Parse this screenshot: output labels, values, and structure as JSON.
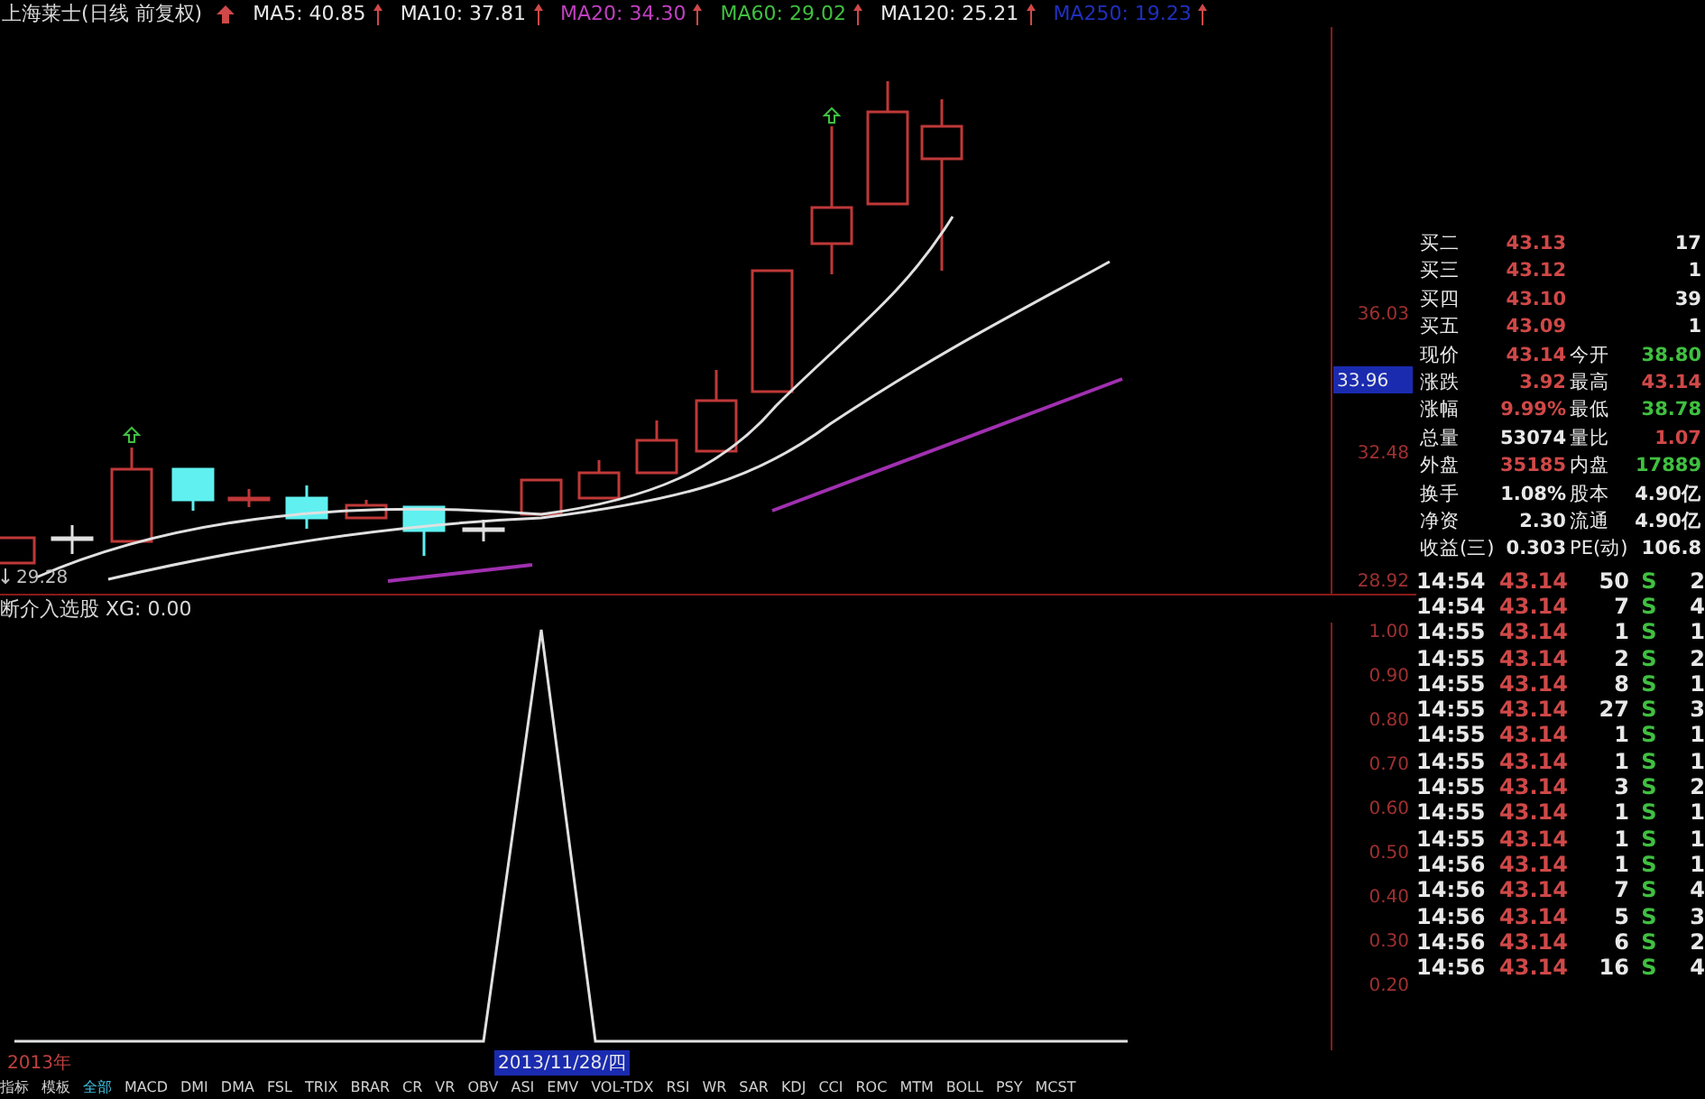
{
  "header": {
    "title": "上海莱士(日线 前复权)",
    "ma": [
      {
        "label": "MA5: 40.85",
        "color": "#e8e8e8"
      },
      {
        "label": "MA10: 37.81",
        "color": "#e8e8e8"
      },
      {
        "label": "MA20: 34.30",
        "color": "#c040c0"
      },
      {
        "label": "MA60: 29.02",
        "color": "#40c040"
      },
      {
        "label": "MA120: 25.21",
        "color": "#e8e8e8"
      },
      {
        "label": "MA250: 19.23",
        "color": "#2030c0"
      }
    ]
  },
  "price_panel": {
    "axis_labels": [
      "36.03",
      "32.48",
      "28.92"
    ],
    "cursor_value": "33.96",
    "low_label": "29.28"
  },
  "indicator_panel": {
    "title": "断介入选股 XG: 0.00",
    "axis_labels": [
      "1.00",
      "0.90",
      "0.80",
      "0.70",
      "0.60",
      "0.50",
      "0.40",
      "0.30",
      "0.20"
    ]
  },
  "date_bar": {
    "year": "2013年",
    "cursor_date": "2013/11/28/四"
  },
  "tabs": [
    {
      "label": "指标",
      "selected": false
    },
    {
      "label": "模板",
      "selected": false
    },
    {
      "label": "全部",
      "selected": true
    },
    {
      "label": "MACD",
      "selected": false
    },
    {
      "label": "DMI",
      "selected": false
    },
    {
      "label": "DMA",
      "selected": false
    },
    {
      "label": "FSL",
      "selected": false
    },
    {
      "label": "TRIX",
      "selected": false
    },
    {
      "label": "BRAR",
      "selected": false
    },
    {
      "label": "CR",
      "selected": false
    },
    {
      "label": "VR",
      "selected": false
    },
    {
      "label": "OBV",
      "selected": false
    },
    {
      "label": "ASI",
      "selected": false
    },
    {
      "label": "EMV",
      "selected": false
    },
    {
      "label": "VOL-TDX",
      "selected": false
    },
    {
      "label": "RSI",
      "selected": false
    },
    {
      "label": "WR",
      "selected": false
    },
    {
      "label": "SAR",
      "selected": false
    },
    {
      "label": "KDJ",
      "selected": false
    },
    {
      "label": "CCI",
      "selected": false
    },
    {
      "label": "ROC",
      "selected": false
    },
    {
      "label": "MTM",
      "selected": false
    },
    {
      "label": "BOLL",
      "selected": false
    },
    {
      "label": "PSY",
      "selected": false
    },
    {
      "label": "MCST",
      "selected": false
    }
  ],
  "quote": [
    {
      "left": {
        "label": "买二",
        "value": "43.13",
        "color": "#d04848"
      },
      "right": {
        "value": "17",
        "color": "#e8e8e8"
      }
    },
    {
      "left": {
        "label": "买三",
        "value": "43.12",
        "color": "#d04848"
      },
      "right": {
        "value": "1",
        "color": "#e8e8e8"
      }
    },
    {
      "left": {
        "label": "买四",
        "value": "43.10",
        "color": "#d04848"
      },
      "right": {
        "value": "39",
        "color": "#e8e8e8"
      }
    },
    {
      "left": {
        "label": "买五",
        "value": "43.09",
        "color": "#d04848"
      },
      "right": {
        "value": "1",
        "color": "#e8e8e8"
      }
    },
    {
      "left": {
        "label": "现价",
        "value": "43.14",
        "color": "#d04848"
      },
      "right": {
        "label": "今开",
        "value": "38.80",
        "color": "#40c040"
      }
    },
    {
      "left": {
        "label": "涨跌",
        "value": "3.92",
        "color": "#d04848"
      },
      "right": {
        "label": "最高",
        "value": "43.14",
        "color": "#d04848"
      }
    },
    {
      "left": {
        "label": "涨幅",
        "value": "9.99%",
        "color": "#d04848"
      },
      "right": {
        "label": "最低",
        "value": "38.78",
        "color": "#40c040"
      }
    },
    {
      "left": {
        "label": "总量",
        "value": "53074",
        "color": "#e8e8e8"
      },
      "right": {
        "label": "量比",
        "value": "1.07",
        "color": "#d04848"
      }
    },
    {
      "left": {
        "label": "外盘",
        "value": "35185",
        "color": "#d04848"
      },
      "right": {
        "label": "内盘",
        "value": "17889",
        "color": "#40c040"
      }
    },
    {
      "left": {
        "label": "换手",
        "value": "1.08%",
        "color": "#e8e8e8"
      },
      "right": {
        "label": "股本",
        "value": "4.90亿",
        "color": "#e8e8e8"
      }
    },
    {
      "left": {
        "label": "净资",
        "value": "2.30",
        "color": "#e8e8e8"
      },
      "right": {
        "label": "流通",
        "value": "4.90亿",
        "color": "#e8e8e8"
      }
    },
    {
      "left": {
        "label": "收益(三)",
        "value": "0.303",
        "color": "#e8e8e8"
      },
      "right": {
        "label": "PE(动)",
        "value": "106.8",
        "color": "#e8e8e8"
      }
    }
  ],
  "trades": [
    {
      "time": "14:54",
      "price": "43.14",
      "volume": "50",
      "side": "S",
      "count": "2"
    },
    {
      "time": "14:54",
      "price": "43.14",
      "volume": "7",
      "side": "S",
      "count": "4"
    },
    {
      "time": "14:55",
      "price": "43.14",
      "volume": "1",
      "side": "S",
      "count": "1"
    },
    {
      "time": "14:55",
      "price": "43.14",
      "volume": "2",
      "side": "S",
      "count": "2"
    },
    {
      "time": "14:55",
      "price": "43.14",
      "volume": "8",
      "side": "S",
      "count": "1"
    },
    {
      "time": "14:55",
      "price": "43.14",
      "volume": "27",
      "side": "S",
      "count": "3"
    },
    {
      "time": "14:55",
      "price": "43.14",
      "volume": "1",
      "side": "S",
      "count": "1"
    },
    {
      "time": "14:55",
      "price": "43.14",
      "volume": "1",
      "side": "S",
      "count": "1"
    },
    {
      "time": "14:55",
      "price": "43.14",
      "volume": "3",
      "side": "S",
      "count": "2"
    },
    {
      "time": "14:55",
      "price": "43.14",
      "volume": "1",
      "side": "S",
      "count": "1"
    },
    {
      "time": "14:55",
      "price": "43.14",
      "volume": "1",
      "side": "S",
      "count": "1"
    },
    {
      "time": "14:56",
      "price": "43.14",
      "volume": "1",
      "side": "S",
      "count": "1"
    },
    {
      "time": "14:56",
      "price": "43.14",
      "volume": "7",
      "side": "S",
      "count": "4"
    },
    {
      "time": "14:56",
      "price": "43.14",
      "volume": "5",
      "side": "S",
      "count": "3"
    },
    {
      "time": "14:56",
      "price": "43.14",
      "volume": "6",
      "side": "S",
      "count": "2"
    },
    {
      "time": "14:56",
      "price": "43.14",
      "volume": "16",
      "side": "S",
      "count": "4"
    }
  ]
}
